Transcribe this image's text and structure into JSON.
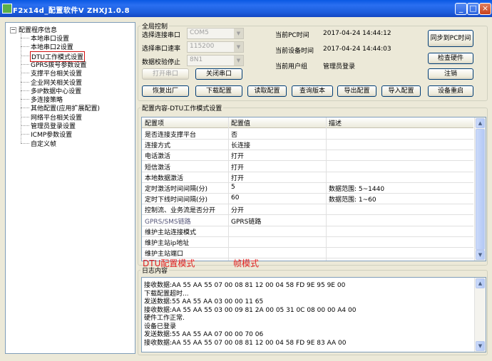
{
  "window": {
    "title": "F2x14d_配置软件V ZHXJ1.0.8"
  },
  "tree": {
    "root": "配置程序信息",
    "items": [
      "本地串口设置",
      "本地串口2设置",
      "DTU工作模式设置",
      "GPRS拨号参数设置",
      "支撑平台相关设置",
      "企业网关相关设置",
      "多IP数据中心设置",
      "多连接策略",
      "其他配置(应用扩展配置)",
      "网络平台相关设置",
      "管理员登录设置",
      "ICMP参数设置",
      "自定义帧"
    ],
    "selected_index": 2
  },
  "control": {
    "legend": "全局控制",
    "port_label": "选择连接串口",
    "port_value": "COM5",
    "baud_label": "选择串口速率",
    "baud_value": "115200",
    "parity_label": "数据校验停止",
    "parity_value": "8N1",
    "open_port": "打开串口",
    "close_port": "关闭串口",
    "pc_time_label": "当前PC时间",
    "pc_time_value": "2017-04-24 14:44:12",
    "dev_time_label": "当前设备时间",
    "dev_time_value": "2017-04-24 14:44:03",
    "user_label": "当前用户组",
    "user_value": "管理员登录",
    "sync_time": "同步到PC时间",
    "check_hw": "检查硬件",
    "logout": "注销",
    "factory_reset": "恢复出厂",
    "download_cfg": "下载配置",
    "read_cfg": "读取配置",
    "query_ver": "查询版本",
    "export_cfg": "导出配置",
    "import_cfg": "导入配置",
    "reboot": "设备重启"
  },
  "config": {
    "legend": "配置内容-DTU工作模式设置",
    "columns": [
      "配置项",
      "配置值",
      "描述"
    ],
    "rows": [
      {
        "item": "是否连接支撑平台",
        "value": "否",
        "desc": ""
      },
      {
        "item": "连接方式",
        "value": "长连接",
        "desc": ""
      },
      {
        "item": "电话激活",
        "value": "打开",
        "desc": ""
      },
      {
        "item": "短信激活",
        "value": "打开",
        "desc": ""
      },
      {
        "item": "本地数据激活",
        "value": "打开",
        "desc": ""
      },
      {
        "item": "定时激活时间间隔(分)",
        "value": "5",
        "desc": "数据范围: 5~1440"
      },
      {
        "item": "定时下线时间间隔(分)",
        "value": "60",
        "desc": "数据范围: 1~60"
      },
      {
        "item": "控制流、业务流是否分开",
        "value": "分开",
        "desc": ""
      },
      {
        "item": "GPRS/SMS链路",
        "value": "GPRS链路",
        "desc": ""
      },
      {
        "item": "维护主站连接模式",
        "value": "",
        "desc": ""
      },
      {
        "item": "维护主站ip地址",
        "value": "",
        "desc": ""
      },
      {
        "item": "维护主站端口",
        "value": "",
        "desc": ""
      }
    ]
  },
  "annotations": {
    "left": "DTU配置模式",
    "right": "帧模式"
  },
  "log": {
    "legend": "日志内容",
    "lines": [
      "接收数据:AA 55 AA 55 07 00 08 81 12 00 04 58 FD 9E 95 9E 00",
      "下载配置超时...",
      "发送数据:55 AA 55 AA 03 00 00 11 65",
      "接收数据:AA 55 AA 55 03 00 09 81 2A 00 05 31 0C 08 00 00 A4 00",
      "硬件工作正常.",
      "设备已登录",
      "发送数据:55 AA 55 AA 07 00 00 70 06",
      "接收数据:AA 55 AA 55 07 00 08 81 12 00 04 58 FD 9E 83 AA 00"
    ]
  },
  "colors": {
    "selection_border": "#d01010",
    "annotation": "#e02020",
    "titlebar": "#0a58e3"
  }
}
